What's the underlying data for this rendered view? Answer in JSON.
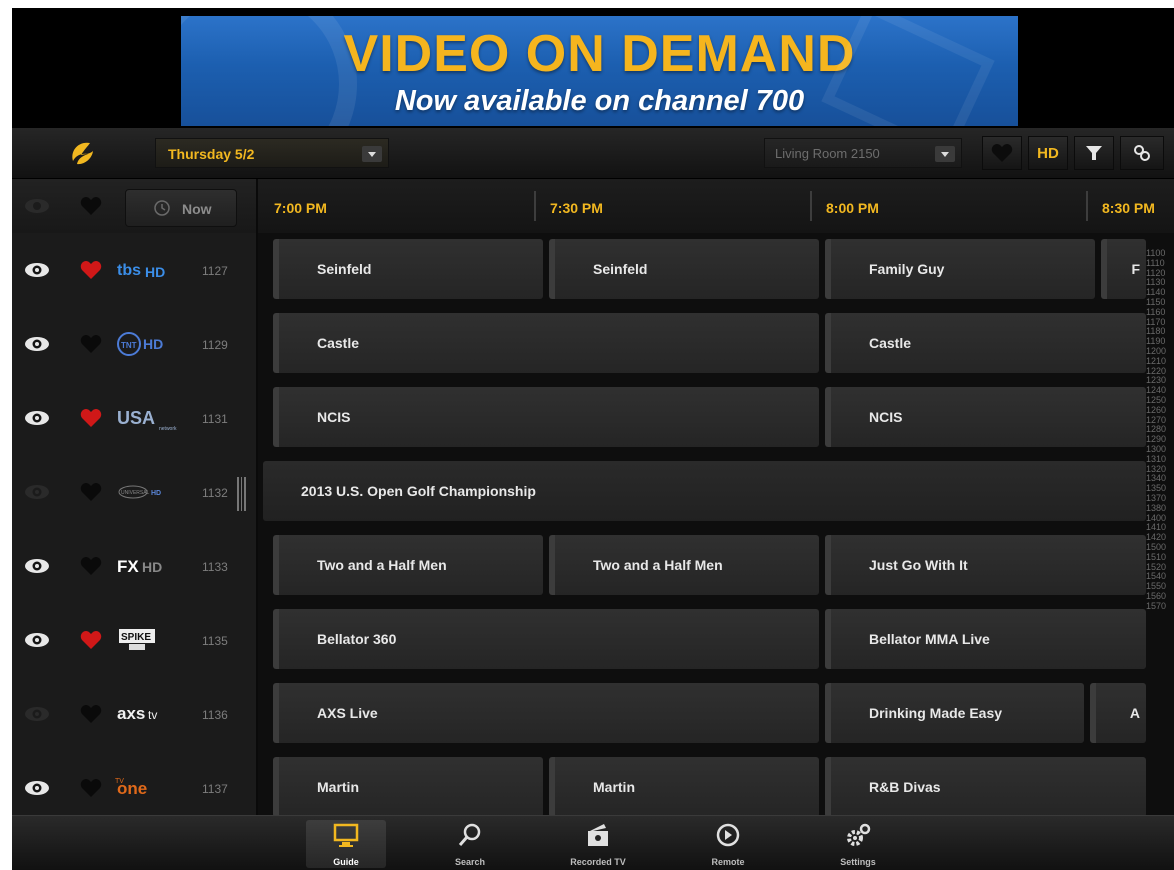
{
  "banner": {
    "title": "VIDEO ON DEMAND",
    "subtitle": "Now available on channel 700"
  },
  "toolbar": {
    "date": "Thursday 5/2",
    "room": "Living Room 2150",
    "hd_label": "HD",
    "icons": [
      "app-logo-icon",
      "heart-icon",
      "filter-icon",
      "link-icon"
    ]
  },
  "now_button": "Now",
  "times": [
    "7:00 PM",
    "7:30 PM",
    "8:00 PM",
    "8:30 PM"
  ],
  "channels": [
    {
      "logo": "tbs HD",
      "number": "1127",
      "favorite": true,
      "watching": true,
      "programs": [
        "Seinfeld",
        "Seinfeld",
        "Family Guy",
        "F"
      ]
    },
    {
      "logo": "TNT HD",
      "number": "1129",
      "favorite": false,
      "watching": true,
      "programs": [
        "Castle",
        "Castle"
      ]
    },
    {
      "logo": "USA network HD",
      "number": "1131",
      "favorite": true,
      "watching": true,
      "programs": [
        "NCIS",
        "NCIS"
      ]
    },
    {
      "logo": "Universal HD",
      "number": "1132",
      "favorite": false,
      "watching": false,
      "programs": [
        "2013 U.S. Open Golf Championship"
      ]
    },
    {
      "logo": "FX HD",
      "number": "1133",
      "favorite": false,
      "watching": true,
      "programs": [
        "Two and a Half Men",
        "Two and a Half Men",
        "Just Go With It"
      ]
    },
    {
      "logo": "SPIKE HD",
      "number": "1135",
      "favorite": true,
      "watching": true,
      "programs": [
        "Bellator 360",
        "Bellator MMA Live"
      ]
    },
    {
      "logo": "AXS tv",
      "number": "1136",
      "favorite": false,
      "watching": false,
      "programs": [
        "AXS Live",
        "Drinking Made Easy",
        "A"
      ]
    },
    {
      "logo": "TV One",
      "number": "1137",
      "favorite": false,
      "watching": true,
      "programs": [
        "Martin",
        "Martin",
        "R&B Divas"
      ]
    }
  ],
  "channel_index": [
    "1100",
    "1110",
    "1120",
    "1130",
    "1140",
    "1150",
    "1160",
    "1170",
    "1180",
    "1190",
    "1200",
    "1210",
    "1220",
    "1230",
    "1240",
    "1250",
    "1260",
    "1270",
    "1280",
    "1290",
    "1300",
    "1310",
    "1320",
    "1340",
    "1350",
    "1370",
    "1380",
    "1400",
    "1410",
    "1420",
    "1500",
    "1510",
    "1520",
    "1540",
    "1550",
    "1560",
    "1570"
  ],
  "nav": [
    {
      "label": "Guide",
      "icon": "tv-icon",
      "active": true
    },
    {
      "label": "Search",
      "icon": "search-icon",
      "active": false
    },
    {
      "label": "Recorded TV",
      "icon": "recorded-tv-icon",
      "active": false
    },
    {
      "label": "Remote",
      "icon": "remote-play-icon",
      "active": false
    },
    {
      "label": "Settings",
      "icon": "settings-gears-icon",
      "active": false
    }
  ],
  "colors": {
    "accent": "#f2b820",
    "favorite": "#d01818",
    "banner_blue": "#1c5fb0"
  }
}
